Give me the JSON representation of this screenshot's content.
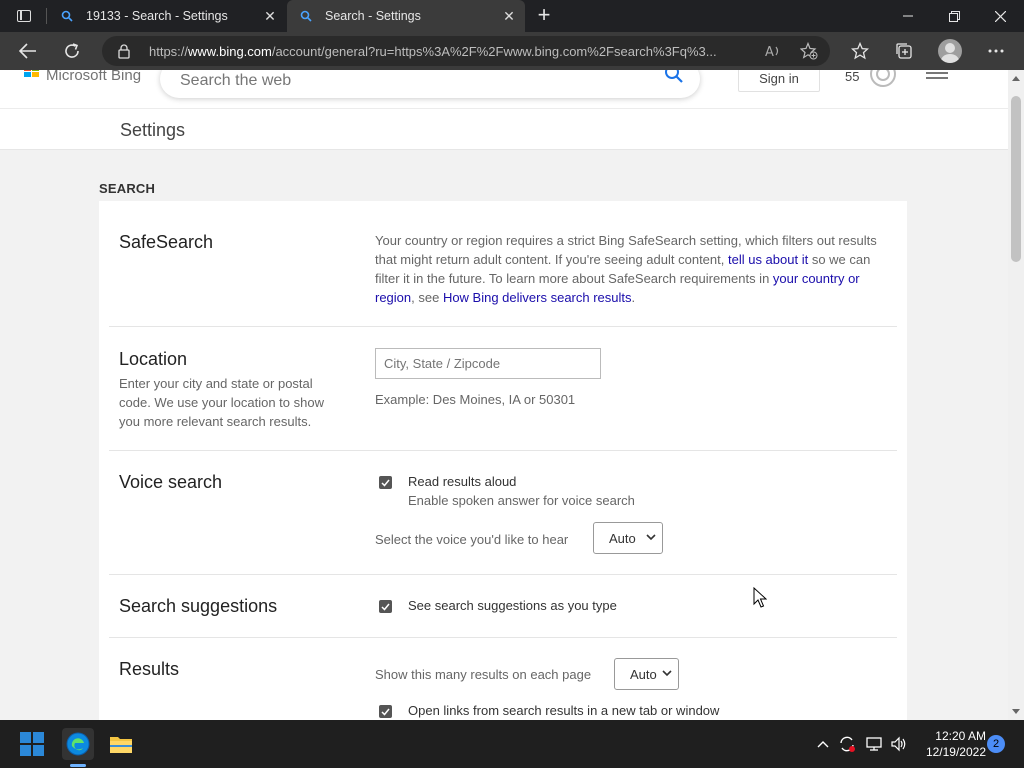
{
  "browser": {
    "tabs": [
      {
        "title": "19133 - Search - Settings",
        "active": false
      },
      {
        "title": "Search - Settings",
        "active": true
      }
    ],
    "url_prefix": "https://",
    "url_host": "www.bing.com",
    "url_rest": "/account/general?ru=https%3A%2F%2Fwww.bing.com%2Fsearch%3Fq%3..."
  },
  "bing_header": {
    "logo_text": "Microsoft Bing",
    "search_placeholder": "Search the web",
    "sign_in": "Sign in",
    "points": "55"
  },
  "settings_bar": {
    "title": "Settings"
  },
  "section": {
    "title": "SEARCH"
  },
  "safesearch": {
    "label": "SafeSearch",
    "text_1": "Your country or region requires a strict Bing SafeSearch setting, which filters out results that might return adult content. If you're seeing adult content, ",
    "link_1": "tell us about it",
    "text_2": " so we can filter it in the future. To learn more about SafeSearch requirements in ",
    "link_2": "your country or region",
    "text_3": ", see ",
    "link_3": "How Bing delivers search results",
    "text_4": "."
  },
  "location": {
    "label": "Location",
    "description": "Enter your city and state or postal code. We use your location to show you more relevant search results.",
    "placeholder": "City, State / Zipcode",
    "example": "Example: Des Moines, IA or 50301"
  },
  "voice_search": {
    "label": "Voice search",
    "checkbox_label": "Read results aloud",
    "checkbox_sub": "Enable spoken answer for voice search",
    "checked": true,
    "select_label": "Select the voice you'd like to hear",
    "select_value": "Auto"
  },
  "search_suggestions": {
    "label": "Search suggestions",
    "checkbox_label": "See search suggestions as you type",
    "checked": true
  },
  "results": {
    "label": "Results",
    "select_label": "Show this many results on each page",
    "select_value": "Auto",
    "checkbox_label": "Open links from search results in a new tab or window",
    "checked": true
  },
  "taskbar": {
    "time": "12:20 AM",
    "date": "12/19/2022",
    "notifications": "2"
  },
  "colors": {
    "link": "#1a0dab",
    "edge_blue": "#0078d4",
    "win_blue": "#2b88d8"
  }
}
